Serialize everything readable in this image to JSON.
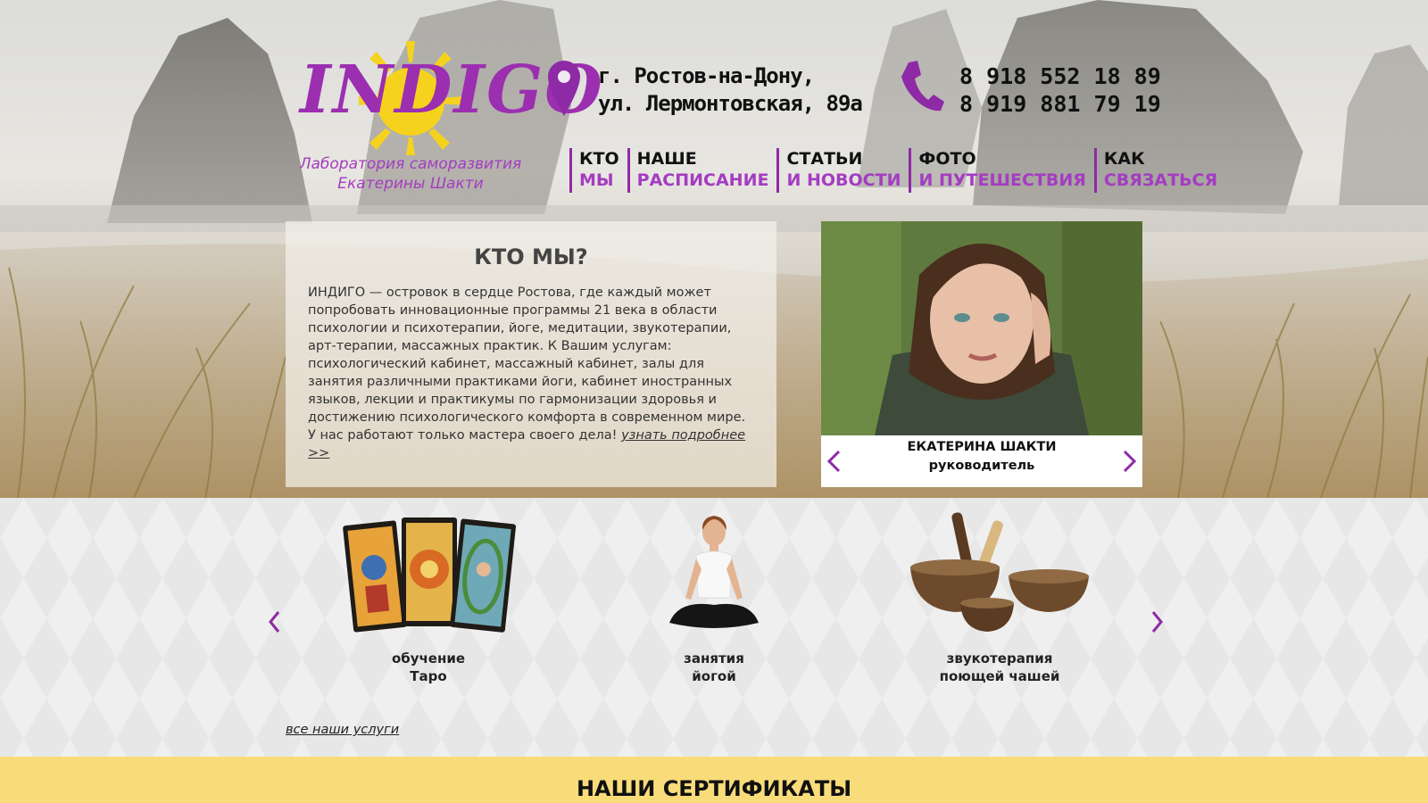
{
  "logo": {
    "word": "INDIGO",
    "tagline_line1": "Лаборатория саморазвития",
    "tagline_line2": "Екатерины Шакти"
  },
  "contacts": {
    "address_line1": "г. Ростов-на-Дону,",
    "address_line2": "ул. Лермонтовская, 89а",
    "phone1": "8 918 552 18 89",
    "phone2": "8 919 881 79 19"
  },
  "nav": [
    {
      "top": "КТО",
      "bottom": "МЫ"
    },
    {
      "top": "НАШЕ",
      "bottom": "РАСПИСАНИЕ"
    },
    {
      "top": "СТАТЬИ",
      "bottom": "И НОВОСТИ"
    },
    {
      "top": "ФОТО",
      "bottom": "И ПУТЕШЕСТВИЯ"
    },
    {
      "top": "КАК",
      "bottom": "СВЯЗАТЬСЯ"
    }
  ],
  "about": {
    "title": "КТО МЫ?",
    "text": "ИНДИГО — островок в сердце Ростова, где каждый может попробовать инновационные программы 21 века в области психологии и психотерапии, йоге, медитации, звукотерапии, арт-терапии, массажных практик. К Вашим услугам: психологический кабинет, массажный кабинет, залы для занятия различными практиками йоги, кабинет иностранных языков, лекции и практикумы по гармонизации здоровья и достижению психологического комфорта в современном мире. У нас работают только мастера своего дела! ",
    "more_link": "узнать подробнее >>"
  },
  "person": {
    "name": "ЕКАТЕРИНА ШАКТИ",
    "role": "руководитель"
  },
  "services": [
    {
      "line1": "обучение",
      "line2": "Таро",
      "icon": "tarot-cards-image"
    },
    {
      "line1": "занятия",
      "line2": "йогой",
      "icon": "yoga-image"
    },
    {
      "line1": "звукотерапия",
      "line2": "поющей чашей",
      "icon": "singing-bowls-image"
    }
  ],
  "services_link": "все наши услуги",
  "certificates_title": "НАШИ СЕРТИФИКАТЫ",
  "colors": {
    "accent_purple": "#a43cc2",
    "logo_sun": "#f5d21e",
    "cert_band": "#f9dc7a"
  }
}
